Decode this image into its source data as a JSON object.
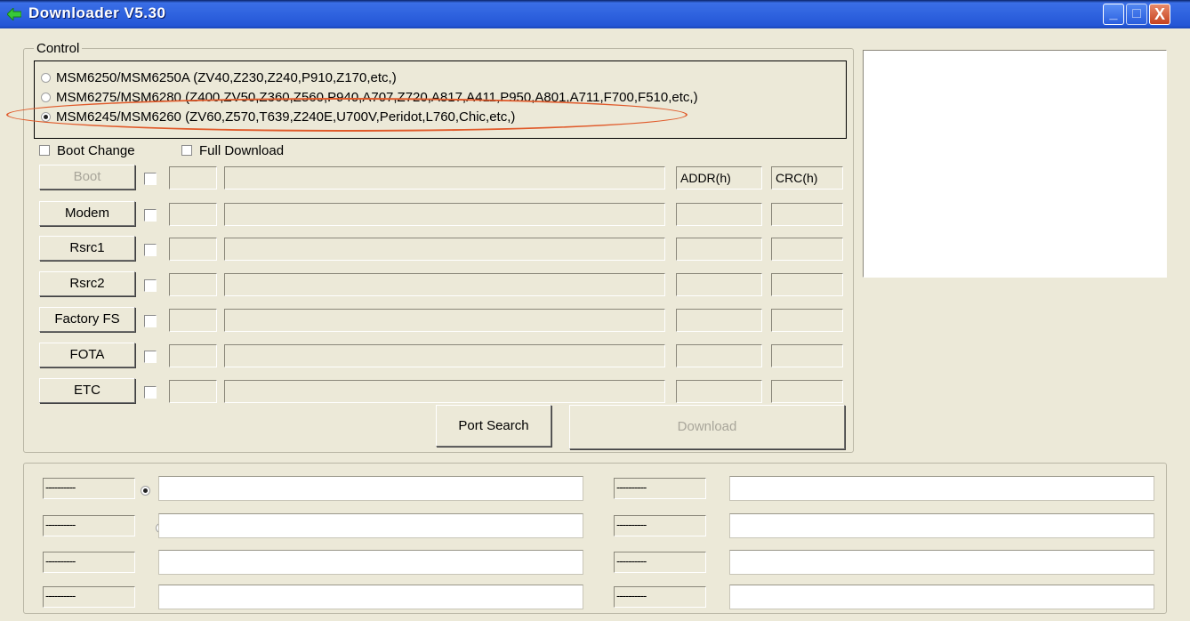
{
  "window": {
    "title": "Downloader V5.30",
    "minimize_symbol": "_",
    "maximize_symbol": "□",
    "close_symbol": "X",
    "title_color": "#2f63df"
  },
  "control": {
    "legend": "Control",
    "models": [
      {
        "label": "MSM6250/MSM6250A (ZV40,Z230,Z240,P910,Z170,etc,)",
        "selected": false
      },
      {
        "label": "MSM6275/MSM6280 (Z400,ZV50,Z360,Z560,P940,A707,Z720,A817,A411,P950,A801,A711,F700,F510,etc,)",
        "selected": false
      },
      {
        "label": "MSM6245/MSM6260 (ZV60,Z570,T639,Z240E,U700V,Peridot,L760,Chic,etc,)",
        "selected": true
      }
    ],
    "highlight_color": "#e05a2a",
    "boot_change_label": "Boot Change",
    "full_download_label": "Full Download",
    "addr_header": "ADDR(h)",
    "crc_header": "CRC(h)",
    "rows": [
      {
        "label": "Boot",
        "enabled": false
      },
      {
        "label": "Modem",
        "enabled": true
      },
      {
        "label": "Rsrc1",
        "enabled": true
      },
      {
        "label": "Rsrc2",
        "enabled": true
      },
      {
        "label": "Factory FS",
        "enabled": true
      },
      {
        "label": "FOTA",
        "enabled": true
      },
      {
        "label": "ETC",
        "enabled": true
      }
    ],
    "port_search_label": "Port Search",
    "download_label": "Download"
  },
  "ports": {
    "placeholder": "----------",
    "left": [
      {
        "selected": true
      },
      {
        "selected": false
      },
      {
        "selected": false
      },
      {
        "selected": false
      }
    ],
    "right": [
      {
        "selected": false
      },
      {
        "selected": false
      },
      {
        "selected": false
      },
      {
        "selected": false
      }
    ]
  }
}
